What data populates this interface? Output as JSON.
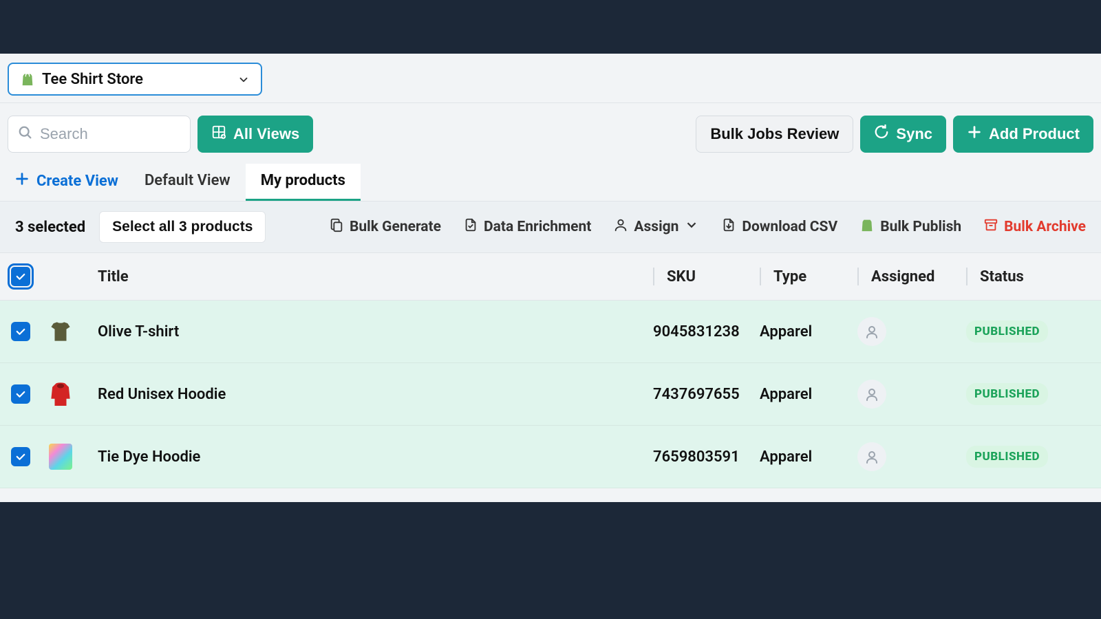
{
  "store_selector": {
    "name": "Tee Shirt Store"
  },
  "search": {
    "placeholder": "Search"
  },
  "toolbar": {
    "all_views": "All Views",
    "bulk_jobs_review": "Bulk Jobs Review",
    "sync": "Sync",
    "add_product": "Add Product"
  },
  "tabs": {
    "create_view": "Create View",
    "default_view": "Default View",
    "my_products": "My products"
  },
  "selection": {
    "count_label": "3 selected",
    "select_all": "Select all 3 products",
    "bulk_generate": "Bulk Generate",
    "data_enrichment": "Data Enrichment",
    "assign": "Assign",
    "download_csv": "Download CSV",
    "bulk_publish": "Bulk Publish",
    "bulk_archive": "Bulk Archive"
  },
  "table": {
    "headers": {
      "title": "Title",
      "sku": "SKU",
      "type": "Type",
      "assigned": "Assigned",
      "status": "Status"
    },
    "rows": [
      {
        "title": "Olive T-shirt",
        "sku": "9045831238",
        "type": "Apparel",
        "status": "PUBLISHED",
        "thumb": "olive-tee"
      },
      {
        "title": "Red Unisex Hoodie",
        "sku": "7437697655",
        "type": "Apparel",
        "status": "PUBLISHED",
        "thumb": "red-hoodie"
      },
      {
        "title": "Tie Dye Hoodie",
        "sku": "7659803591",
        "type": "Apparel",
        "status": "PUBLISHED",
        "thumb": "tiedye-hoodie"
      }
    ]
  }
}
